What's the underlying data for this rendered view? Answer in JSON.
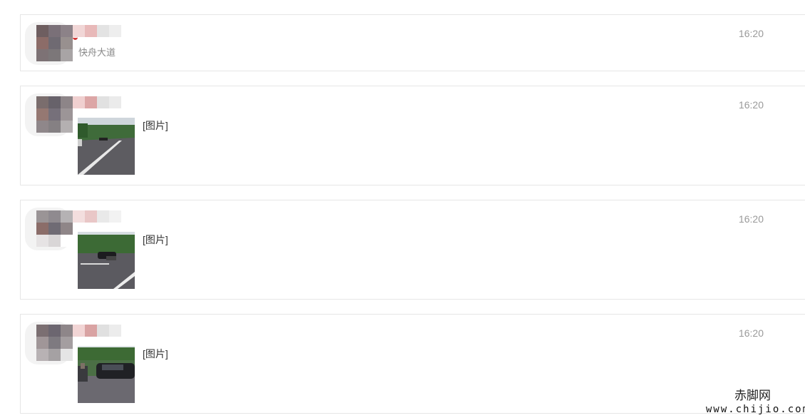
{
  "messages": [
    {
      "time": "16:20",
      "subtitle": "快舟大道",
      "has_image": false,
      "image_label": ""
    },
    {
      "time": "16:20",
      "subtitle": "",
      "has_image": true,
      "image_label": "[图片]",
      "image_desc_icon": "road-photo-thumbnail"
    },
    {
      "time": "16:20",
      "subtitle": "",
      "has_image": true,
      "image_label": "[图片]",
      "image_desc_icon": "road-accident-photo-thumbnail"
    },
    {
      "time": "16:20",
      "subtitle": "",
      "has_image": true,
      "image_label": "[图片]",
      "image_desc_icon": "damaged-car-photo-thumbnail"
    }
  ],
  "watermark": {
    "site_name": "赤脚网",
    "url": "www.chijio.com"
  },
  "colors": {
    "card_border": "#e6e6e6",
    "time_text": "#9a9a9a",
    "label_text": "#333333"
  }
}
